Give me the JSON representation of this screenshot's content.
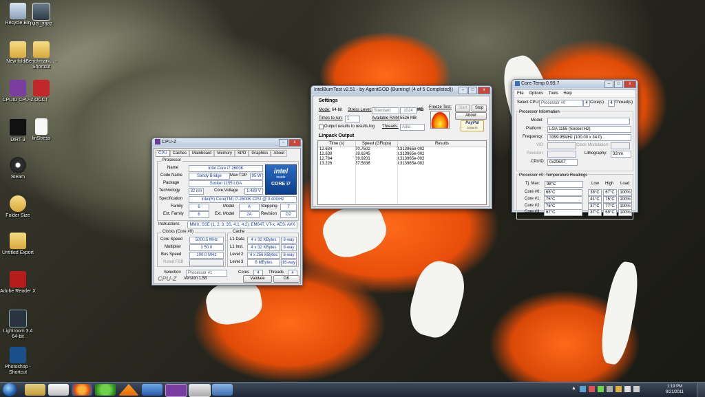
{
  "desktop_icons": [
    {
      "label": "Recycle Bin",
      "icon": "recycle-bin-icon"
    },
    {
      "label": "IMG_3382",
      "icon": "image-file-icon"
    },
    {
      "label": "New folder",
      "icon": "folder-icon"
    },
    {
      "label": "Benchmark... - Shortcut",
      "icon": "folder-shortcut-icon"
    },
    {
      "label": "CPUID CPU-Z",
      "icon": "cpuz-app-icon"
    },
    {
      "label": "OCCT",
      "icon": "occt-app-icon"
    },
    {
      "label": "DiRT 3",
      "icon": "dirt3-game-icon"
    },
    {
      "label": "linStress",
      "icon": "document-icon"
    },
    {
      "label": "Steam",
      "icon": "steam-icon"
    },
    {
      "label": "Folder Size",
      "icon": "folder-size-icon"
    },
    {
      "label": "Untitled Export",
      "icon": "folder-icon"
    },
    {
      "label": "Adobe Reader X",
      "icon": "adobe-reader-icon"
    },
    {
      "label": "Lightroom 3.4 64-bit",
      "icon": "lightroom-icon"
    },
    {
      "label": "Photoshop - Shortcut",
      "icon": "photoshop-icon"
    }
  ],
  "cpuz": {
    "title": "CPU-Z",
    "tabs": [
      "CPU",
      "Caches",
      "Mainboard",
      "Memory",
      "SPD",
      "Graphics",
      "About"
    ],
    "processor_group": "Processor",
    "name_label": "Name",
    "name": "Intel Core i7 2600K",
    "codename_label": "Code Name",
    "codename": "Sandy Bridge",
    "maxtdp_label": "Max TDP",
    "maxtdp": "95 W",
    "package_label": "Package",
    "package": "Socket 1155 LGA",
    "technology_label": "Technology",
    "technology": "32 nm",
    "voltage_label": "Core Voltage",
    "voltage": "1.480 V",
    "spec_label": "Specification",
    "spec": "Intel(R) Core(TM) i7-2600K CPU @ 3.40GHz",
    "family_label": "Family",
    "family": "6",
    "model_label": "Model",
    "model": "A",
    "stepping_label": "Stepping",
    "stepping": "7",
    "extfamily_label": "Ext. Family",
    "extfamily": "6",
    "extmodel_label": "Ext. Model",
    "extmodel": "2A",
    "revision_label": "Revision",
    "revision": "D2",
    "instr_label": "Instructions",
    "instr": "MMX, SSE (1, 2, 3, 3S, 4.1, 4.2), EM64T, VT-x, AES, AVX",
    "logo_brand": "intel",
    "logo_inside": "inside",
    "logo_model": "CORE i7",
    "clocks_group": "Clocks (Core #0)",
    "corespeed_label": "Core Speed",
    "corespeed": "5000.5 MHz",
    "multiplier_label": "Multiplier",
    "multiplier": "x 50.0",
    "busspeed_label": "Bus Speed",
    "busspeed": "100.0 MHz",
    "ratedfsb_label": "Rated FSB",
    "ratedfsb": "",
    "cache_group": "Cache",
    "l1d_label": "L1 Data",
    "l1d": "4 x 32 KBytes",
    "l1d_way": "8-way",
    "l1i_label": "L1 Inst.",
    "l1i": "4 x 32 KBytes",
    "l1i_way": "8-way",
    "l2_label": "Level 2",
    "l2": "4 x 256 KBytes",
    "l2_way": "8-way",
    "l3_label": "Level 3",
    "l3": "8 MBytes",
    "l3_way": "16-way",
    "selection_label": "Selection",
    "selection": "Processor #1",
    "cores_label": "Cores",
    "cores": "4",
    "threads_label": "Threads",
    "threads": "4",
    "brand": "CPU-Z",
    "version": "Version 1.58",
    "validate": "Validate",
    "ok": "OK"
  },
  "ibt": {
    "title": "IntelBurnTest v2.51 - by AgentGOD  (Burning! (4 of 5 Completed))",
    "settings": "Settings",
    "mode_label": "Mode:",
    "mode": "64-bit",
    "stress_label": "Stress Level:",
    "stress": "Standard",
    "stress_mb": "1024",
    "mb": "MB",
    "times_label": "Times to run:",
    "times": "5",
    "ram_label": "Available RAM:",
    "ram": "5526 MB",
    "output_check": "Output results to results.log",
    "threads_label": "Threads:",
    "threads": "Auto",
    "freeze_label": "Freeze Test:",
    "start": "Start",
    "stop": "Stop",
    "about": "About",
    "paypal": "PayPal",
    "donate": "DONATE",
    "linpack": "Linpack Output",
    "col_time": "Time (s)",
    "col_speed": "Speed (GFlops)",
    "col_results": "Results",
    "rows": [
      {
        "time": "12.634",
        "speed": "70.7502",
        "result": "3.313965e-002"
      },
      {
        "time": "12.839",
        "speed": "69.6245",
        "result": "3.313965e-002"
      },
      {
        "time": "12.784",
        "speed": "69.9201",
        "result": "3.313965e-002"
      },
      {
        "time": "13.226",
        "speed": "67.5836",
        "result": "3.313965e-002"
      }
    ]
  },
  "coretemp": {
    "title": "Core Temp 0.99.7",
    "menu": [
      "File",
      "Options",
      "Tools",
      "Help"
    ],
    "select_label": "Select CPU:",
    "select": "Processor #0",
    "cores_count": "4",
    "cores_text": "Core(s)",
    "threads_count": "4",
    "threads_text": "Thread(s)",
    "proc_info": "Processor Information",
    "model_label": "Model:",
    "model": "",
    "platform_label": "Platform:",
    "platform": "LGA 1155 (Socket H2)",
    "freq_label": "Frequency:",
    "freq": "3399.95MHz (100.00 x 34.0)",
    "vid_label": "VID:",
    "clockmod_label": "Clock Modulation:",
    "revision_label": "Revision:",
    "litho_label": "Lithography:",
    "litho": "32nm",
    "cpuid_label": "CPUID:",
    "cpuid": "0x206A7",
    "temp_title": "Processor #0: Temperature Readings",
    "tjmax_label": "Tj. Max:",
    "tjmax": "98°C",
    "col_low": "Low",
    "col_high": "High",
    "col_load": "Load",
    "cores": [
      {
        "label": "Core #0:",
        "temp": "66°C",
        "low": "38°C",
        "high": "67°C",
        "load": "100%"
      },
      {
        "label": "Core #1:",
        "temp": "75°C",
        "low": "41°C",
        "high": "75°C",
        "load": "100%"
      },
      {
        "label": "Core #2:",
        "temp": "76°C",
        "low": "37°C",
        "high": "77°C",
        "load": "100%"
      },
      {
        "label": "Core #3:",
        "temp": "67°C",
        "low": "37°C",
        "high": "69°C",
        "load": "100%"
      }
    ]
  },
  "taskbar": {
    "apps": [
      "start-orb-icon",
      "file-explorer-icon",
      "media-player-icon",
      "firefox-icon",
      "utorrent-icon",
      "vlc-icon",
      "network-icon",
      "cpuz-taskbar-icon",
      "intelburntest-taskbar-icon",
      "coretemp-taskbar-icon"
    ],
    "time": "1:19 PM",
    "date": "8/21/2011"
  }
}
